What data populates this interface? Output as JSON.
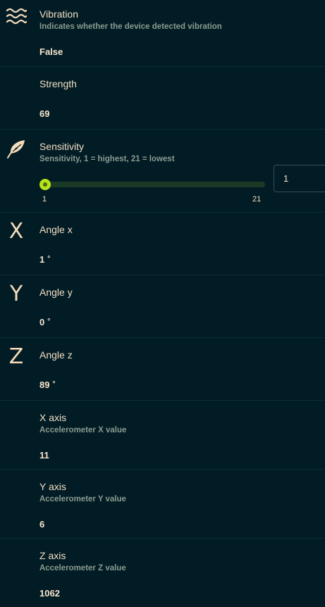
{
  "rows": {
    "vibration": {
      "title": "Vibration",
      "subtitle": "Indicates whether the device detected vibration",
      "value": "False",
      "icon": "waves-icon"
    },
    "strength": {
      "title": "Strength",
      "value": "69"
    },
    "sensitivity": {
      "title": "Sensitivity",
      "subtitle": "Sensitivity, 1 = highest, 21 = lowest",
      "icon": "feather-icon",
      "slider_min_label": "1",
      "slider_max_label": "21",
      "slider_value": 1,
      "input_value": "1"
    },
    "angle_x": {
      "title": "Angle x",
      "value": "1",
      "unit": "°",
      "icon_letter": "X"
    },
    "angle_y": {
      "title": "Angle y",
      "value": "0",
      "unit": "°",
      "icon_letter": "Y"
    },
    "angle_z": {
      "title": "Angle z",
      "value": "89",
      "unit": "°",
      "icon_letter": "Z"
    },
    "x_axis": {
      "title": "X axis",
      "subtitle": "Accelerometer X value",
      "value": "11"
    },
    "y_axis": {
      "title": "Y axis",
      "subtitle": "Accelerometer Y value",
      "value": "6"
    },
    "z_axis": {
      "title": "Z axis",
      "subtitle": "Accelerometer Z value",
      "value": "1062"
    }
  },
  "colors": {
    "background": "#021c26",
    "text": "#f3dec2",
    "subtitle": "#8a9a8e",
    "slider_accent": "#b6e41a",
    "slider_track": "#1b3a26"
  }
}
